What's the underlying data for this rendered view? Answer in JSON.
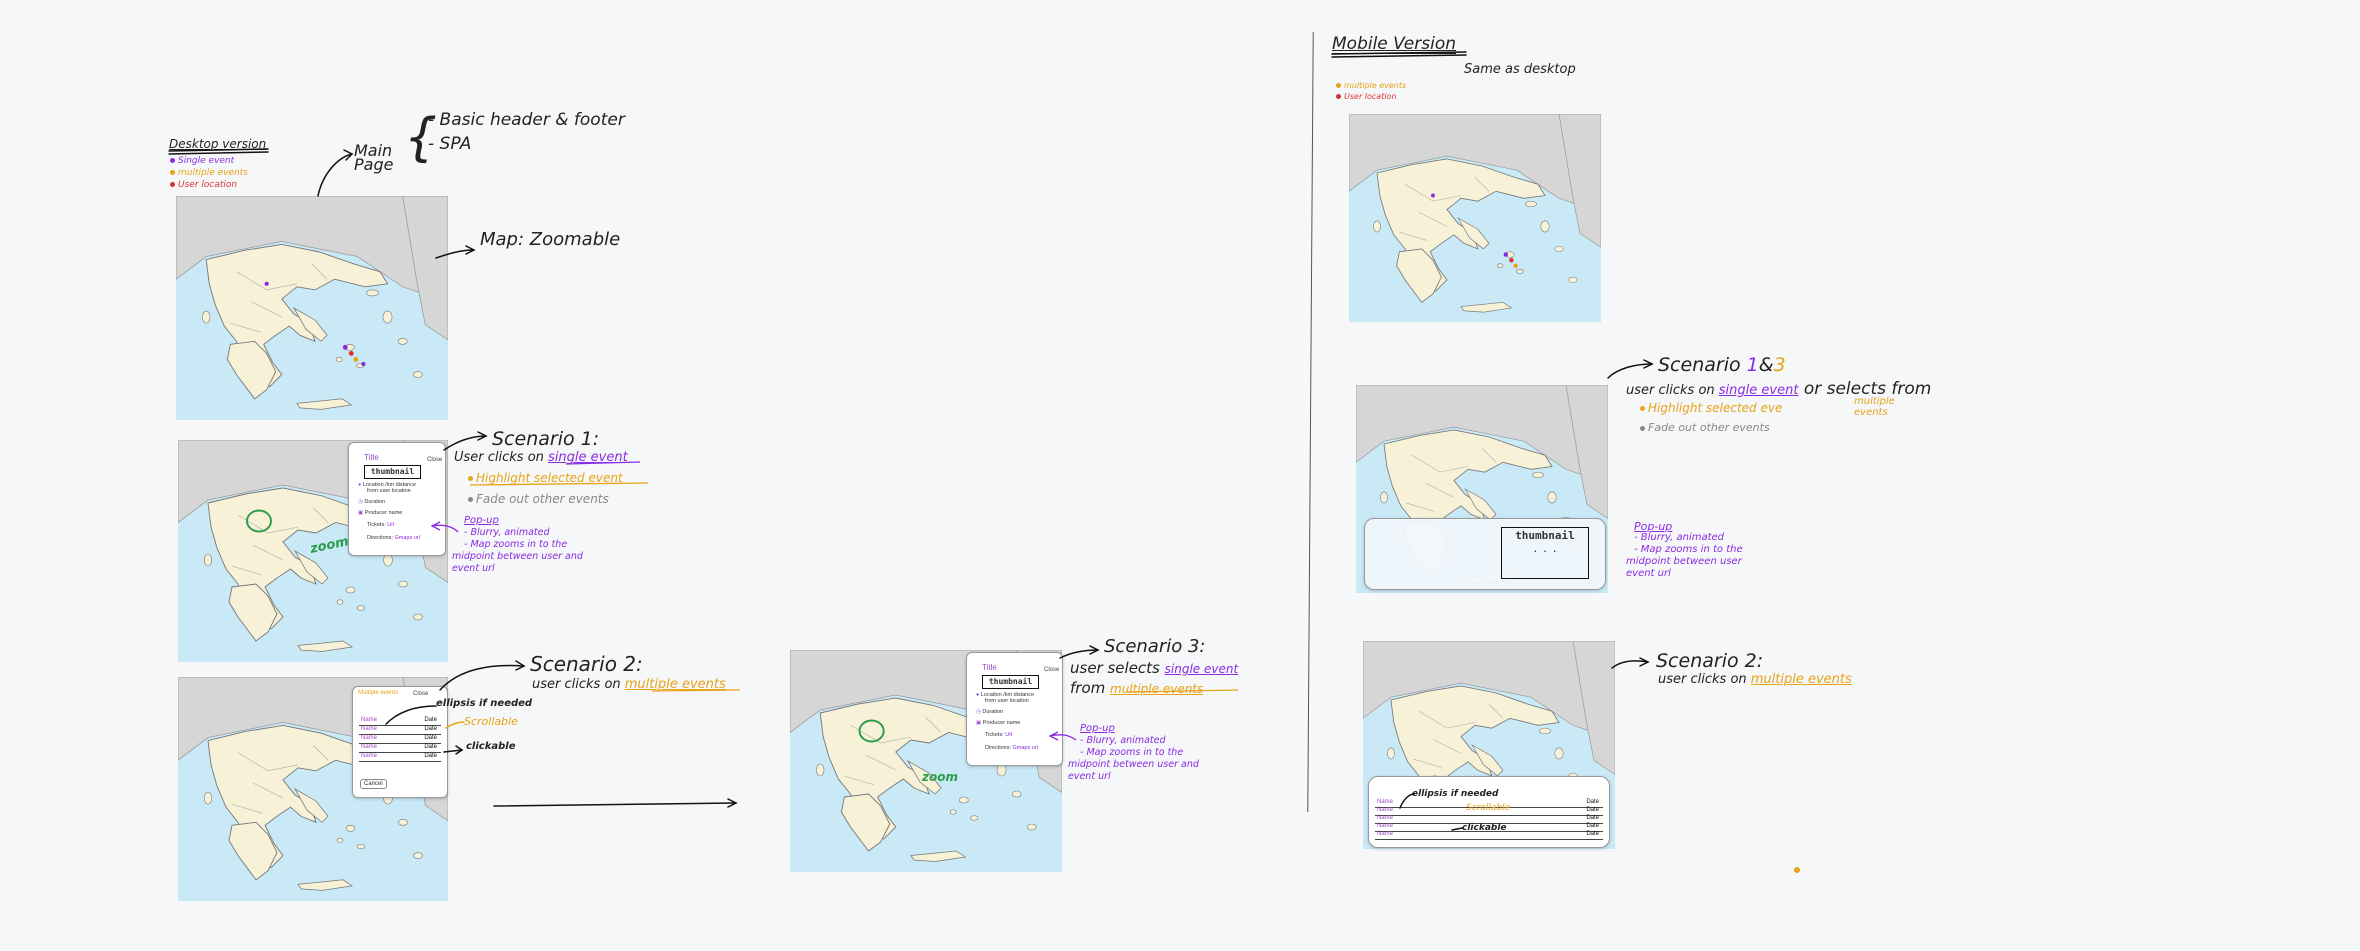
{
  "desktop": {
    "heading": "Desktop version",
    "legend": [
      {
        "label": "Single event",
        "color": "#8a2be2"
      },
      {
        "label": "multiple events",
        "color": "#e8a317"
      },
      {
        "label": "User location",
        "color": "#d33333"
      }
    ],
    "main_page": "Main Page",
    "notes": [
      "- Basic header & footer",
      "- SPA"
    ],
    "map_note": "Map: Zoomable"
  },
  "scenario1": {
    "title": "Scenario 1:",
    "line1_prefix": "User clicks on ",
    "line1_link": "single event",
    "bullet_highlight": "Highlight selected event",
    "bullet_fade": "Fade out other events",
    "popup_label": "Pop-up",
    "popup_desc": [
      "- Blurry, animated",
      "- Map zooms in to the",
      "midpoint between user and",
      "event url"
    ],
    "zoom_label": "zoom"
  },
  "popup": {
    "title": "Title",
    "close": "Close",
    "thumbnail": "thumbnail",
    "location": "Location /km distance",
    "location2": "from user location",
    "duration": "Duration",
    "producer": "Producer name",
    "tickets_label": "Tickets:",
    "tickets_value": "Url",
    "directions_label": "Directions:",
    "directions_value": "Gmaps url"
  },
  "scenario2": {
    "title": "Scenario 2:",
    "line1_prefix": "user clicks on ",
    "line1_link": "multiple events",
    "ellipsis_note": "ellipsis if needed",
    "scrollable_note": "Scrollable",
    "clickable_note": "clickable",
    "list_header": "Multiple events",
    "list_close": "Close",
    "rows": [
      {
        "name": "Name",
        "date": "Date"
      },
      {
        "name": "Name",
        "date": "Date"
      },
      {
        "name": "Name",
        "date": "Date"
      },
      {
        "name": "Name",
        "date": "Date"
      },
      {
        "name": "Name",
        "date": "Date"
      }
    ],
    "cancel": "Cancel"
  },
  "scenario3": {
    "title": "Scenario 3:",
    "line1_prefix": "user selects ",
    "line1_link": "single event",
    "line2_prefix": "from ",
    "line2_link": "multiple events",
    "popup_label": "Pop-up",
    "popup_desc": [
      "- Blurry, animated",
      "- Map zooms in to the",
      "midpoint between user and",
      "event url"
    ],
    "zoom_label": "zoom"
  },
  "mobile": {
    "heading": "Mobile Version",
    "same_note": "Same as desktop",
    "legend": [
      {
        "label": "multiple events",
        "color": "#e8a317"
      },
      {
        "label": "User location",
        "color": "#d33333"
      }
    ],
    "scenario13_title": "Scenario",
    "scenario13_nums": [
      "1",
      "&",
      "3"
    ],
    "s13_line_prefix": "user clicks on ",
    "s13_line_link": "single event",
    "s13_line_suffix": " or selects from",
    "s13_multiple": "multiple events",
    "s13_highlight": "Highlight selected eve",
    "s13_fade": "Fade out other events",
    "s13_popup_label": "Pop-up",
    "s13_popup_desc": [
      "- Blurry, animated",
      "- Map zooms in to the",
      "midpoint between user",
      "event url"
    ],
    "thumbnail": "thumbnail",
    "scenario2_title": "Scenario 2:",
    "s2_line_prefix": "user clicks on ",
    "s2_line_link": "multiple events",
    "s2_ellipsis": "ellipsis if needed",
    "s2_scrollable": "Scrollable",
    "s2_clickable": "clickable"
  }
}
